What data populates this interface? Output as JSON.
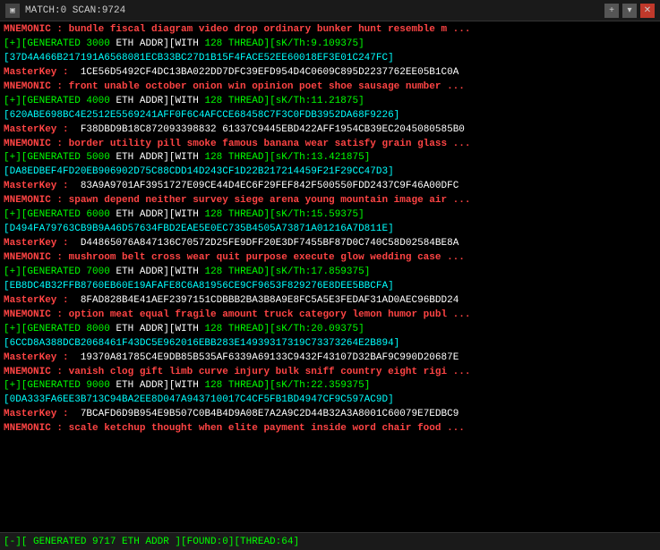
{
  "titlebar": {
    "title": "MATCH:0 SCAN:9724",
    "icon": "▣",
    "close_label": "✕",
    "plus_label": "+",
    "down_label": "▾"
  },
  "bottombar": {
    "text": "[-][ GENERATED 9717 ETH ADDR ][FOUND:0][THREAD:64]"
  },
  "lines": [
    {
      "type": "mnemonic",
      "text": "MNEMONIC : bundle fiscal diagram video drop ordinary bunker hunt resemble m ..."
    },
    {
      "type": "generated",
      "prefix": "[+][GENERATED",
      "num": "3000",
      "mid": "ETH ADDR][WITH",
      "threads": "128",
      "thread_label": "THREAD][sK/Th:",
      "sk": "9.109375",
      "suffix": "]"
    },
    {
      "type": "hex_cyan",
      "text": "[37D4A466B217191A6568081ECB33BC27D1B15F4FACE52EE60018EF3E01C247FC]"
    },
    {
      "type": "masterkey",
      "label": "MasterKey :",
      "val": "  1CE56D5492CF4DC13BA022DD7DFC39EFD954D4C0609C895D2237762EE05B1C0A"
    },
    {
      "type": "mnemonic",
      "text": "MNEMONIC : front unable october onion win opinion poet shoe sausage number ..."
    },
    {
      "type": "generated",
      "prefix": "[+][GENERATED",
      "num": "4000",
      "mid": "ETH ADDR][WITH",
      "threads": "128",
      "thread_label": "THREAD][sK/Th:",
      "sk": "11.21875",
      "suffix": "]"
    },
    {
      "type": "hex_cyan",
      "text": "[620ABE698BC4E2512E5569241AFF0F6C4AFCCE68458C7F3C0FDB3952DA68F9226]"
    },
    {
      "type": "masterkey",
      "label": "MasterKey :",
      "val": "  F38DBD9B18C872093398832 61337C9445EBD422AFF1954CB39EC2045080585B0"
    },
    {
      "type": "mnemonic",
      "text": "MNEMONIC : border utility pill smoke famous banana wear satisfy grain glass ..."
    },
    {
      "type": "generated",
      "prefix": "[+][GENERATED",
      "num": "5000",
      "mid": "ETH ADDR][WITH",
      "threads": "128",
      "thread_label": "THREAD][sK/Th:",
      "sk": "13.421875",
      "suffix": "]"
    },
    {
      "type": "hex_cyan",
      "text": "[DA8EDBEF4FD20EB906902D75C88CDD14D243CF1D22B217214459F21F29CC47D3]"
    },
    {
      "type": "masterkey",
      "label": "MasterKey :",
      "val": "  83A9A9701AF3951727E09CE44D4EC6F29FEF842F500550FDD2437C9F46A00DFC"
    },
    {
      "type": "mnemonic",
      "text": "MNEMONIC : spawn depend neither survey siege arena young mountain image air ..."
    },
    {
      "type": "generated",
      "prefix": "[+][GENERATED",
      "num": "6000",
      "mid": "ETH ADDR][WITH",
      "threads": "128",
      "thread_label": "THREAD][sK/Th:",
      "sk": "15.59375",
      "suffix": "]"
    },
    {
      "type": "hex_cyan",
      "text": "[D494FA79763CB9B9A46D57634FBD2EAE5E0EC735B4505A73871A01216A7D811E]"
    },
    {
      "type": "masterkey",
      "label": "MasterKey :",
      "val": "  D44865076A847136C70572D25FE9DFF20E3DF7455BF87D0C740C58D02584BE8A"
    },
    {
      "type": "mnemonic",
      "text": "MNEMONIC : mushroom belt cross wear quit purpose execute glow wedding case ..."
    },
    {
      "type": "generated",
      "prefix": "[+][GENERATED",
      "num": "7000",
      "mid": "ETH ADDR][WITH",
      "threads": "128",
      "thread_label": "THREAD][sK/Th:",
      "sk": "17.859375",
      "suffix": "]"
    },
    {
      "type": "hex_cyan",
      "text": "[EB8DC4B32FFB8760EB60E19AFAFE8C6A81956CE9CF9653F829276E8DEE5BBCFA]"
    },
    {
      "type": "masterkey",
      "label": "MasterKey :",
      "val": "  8FAD828B4E41AEF2397151CDBBB2BA3B8A9E8FC5A5E3FEDAF31AD0AEC96BDD24"
    },
    {
      "type": "mnemonic",
      "text": "MNEMONIC : option meat equal fragile amount truck category lemon humor publ ..."
    },
    {
      "type": "generated",
      "prefix": "[+][GENERATED",
      "num": "8000",
      "mid": "ETH ADDR][WITH",
      "threads": "128",
      "thread_label": "THREAD][sK/Th:",
      "sk": "20.09375",
      "suffix": "]"
    },
    {
      "type": "hex_cyan",
      "text": "[6CCD8A388DCB2068461F43DC5E962016EBB283E14939317319C73373264E2B894]"
    },
    {
      "type": "masterkey",
      "label": "MasterKey :",
      "val": "  19370A81785C4E9DB85B535AF6339A69133C9432F43107D32BAF9C990D20687E"
    },
    {
      "type": "mnemonic",
      "text": "MNEMONIC : vanish clog gift limb curve injury bulk sniff country eight rigi ..."
    },
    {
      "type": "generated",
      "prefix": "[+][GENERATED",
      "num": "9000",
      "mid": "ETH ADDR][WITH",
      "threads": "128",
      "thread_label": "THREAD][sK/Th:",
      "sk": "22.359375",
      "suffix": "]"
    },
    {
      "type": "hex_cyan",
      "text": "[0DA333FA6EE3B713C94BA2EE8D047A943710017C4CF5FB1BD4947CF9C597AC9D]"
    },
    {
      "type": "masterkey",
      "label": "MasterKey :",
      "val": "  7BCAFD6D9B954E9B507C0B4B4D9A08E7A2A9C2D44B32A3A8001C60079E7EDBC9"
    },
    {
      "type": "mnemonic",
      "text": "MNEMONIC : scale ketchup thought when elite payment inside word chair food ..."
    }
  ]
}
